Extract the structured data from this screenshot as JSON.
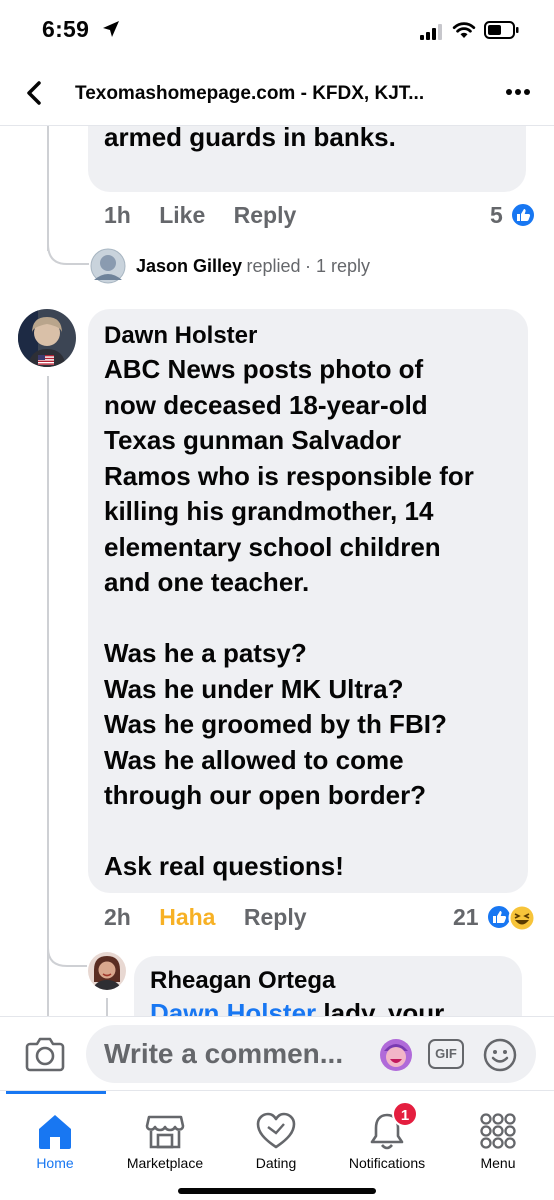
{
  "status_bar": {
    "time": "6:59"
  },
  "header": {
    "title": "Texomashomepage.com - KFDX, KJT..."
  },
  "prev_comment": {
    "text_lines": "work or we wouldn't have\narmed guards in banks.",
    "time": "1h",
    "like_label": "Like",
    "reply_label": "Reply",
    "reaction_count": "5"
  },
  "replies_row": {
    "name": "Jason Gilley",
    "action": "replied",
    "count": "· 1 reply"
  },
  "comment": {
    "author": "Dawn Holster",
    "text": "ABC News posts photo of\nnow deceased 18-year-old\nTexas gunman Salvador\nRamos who is responsible for\nkilling his grandmother, 14\nelementary school children\nand one teacher.\n\nWas he a patsy?\nWas he under MK Ultra?\nWas he groomed by th FBI?\nWas he allowed to come\nthrough our open border?\n\nAsk real questions!",
    "time": "2h",
    "reaction_label": "Haha",
    "reply_label": "Reply",
    "reaction_count": "21"
  },
  "reply": {
    "author": "Rheagan Ortega",
    "mention": "Dawn Holster",
    "text_partial": " lady, your"
  },
  "composer": {
    "placeholder": "Write a commen...",
    "gif_label": "GIF"
  },
  "tabs": [
    {
      "label": "Home"
    },
    {
      "label": "Marketplace"
    },
    {
      "label": "Dating"
    },
    {
      "label": "Notifications",
      "badge": "1"
    },
    {
      "label": "Menu"
    }
  ],
  "colors": {
    "accent": "#1877f2",
    "haha": "#f7b125",
    "badge": "#e41e3f",
    "bubble": "#eff0f3"
  }
}
